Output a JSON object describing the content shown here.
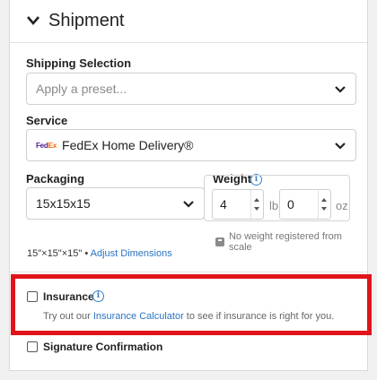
{
  "section": {
    "title": "Shipment"
  },
  "shipping_selection": {
    "label": "Shipping Selection",
    "placeholder": "Apply a preset..."
  },
  "service": {
    "label": "Service",
    "logo_text_fed": "Fed",
    "logo_text_ex": "Ex",
    "value": "FedEx Home Delivery®"
  },
  "packaging": {
    "label": "Packaging",
    "value": "15x15x15"
  },
  "weight": {
    "label": "Weight",
    "lb_value": "4",
    "lb_unit": "lb",
    "oz_value": "0",
    "oz_unit": "oz",
    "scale_note": "No weight registered from scale"
  },
  "dimensions": {
    "text": "15\"×15\"×15\" • ",
    "link": "Adjust Dimensions"
  },
  "insurance": {
    "label": "Insurance",
    "desc_prefix": "Try out our ",
    "desc_link": "Insurance Calculator",
    "desc_suffix": " to see if insurance is right for you."
  },
  "signature": {
    "label": "Signature Confirmation"
  },
  "colors": {
    "highlight": "#e0141b",
    "link": "#2a73c2",
    "info": "#3c82c8"
  }
}
